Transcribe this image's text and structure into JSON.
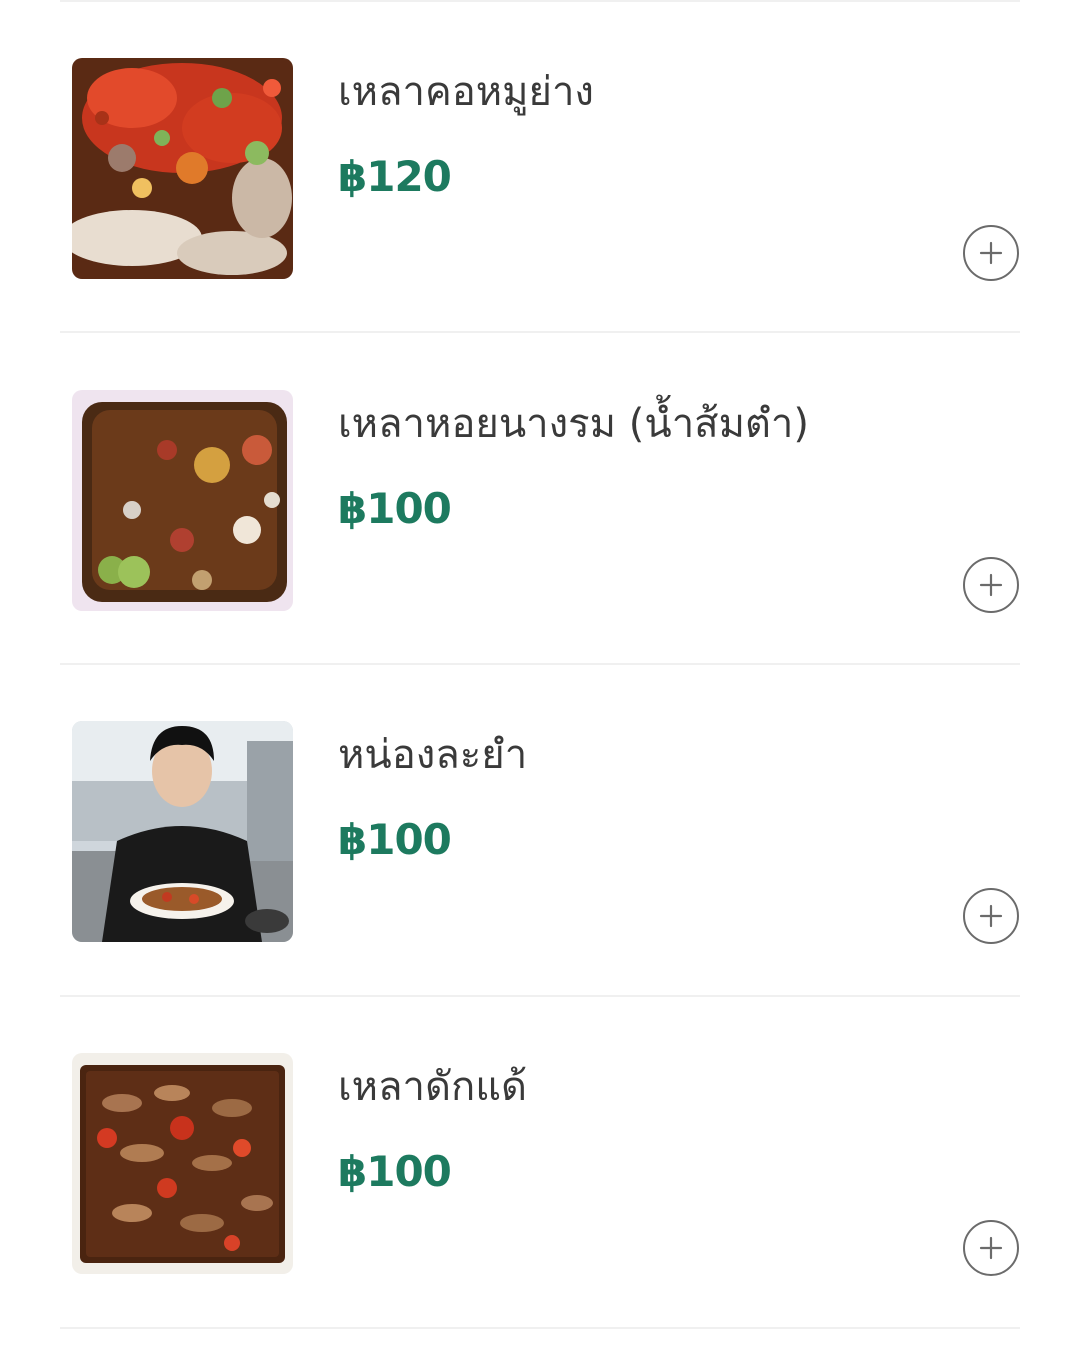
{
  "menu": {
    "items": [
      {
        "name": "เหลาคอหมูย่าง",
        "price": "฿120",
        "image": "grilled-pork-neck-spicy-salad-photo",
        "add_icon": "plus-circle-icon"
      },
      {
        "name": "เหลาหอยนางรม (น้ำส้มตำ)",
        "price": "฿100",
        "image": "oyster-spicy-salad-photo",
        "add_icon": "plus-circle-icon"
      },
      {
        "name": "หน่องละยำ",
        "price": "฿100",
        "image": "man-holding-dish-photo",
        "add_icon": "plus-circle-icon"
      },
      {
        "name": "เหลาดักแด้",
        "price": "฿100",
        "image": "silkworm-pupae-spicy-salad-photo",
        "add_icon": "plus-circle-icon"
      }
    ]
  },
  "colors": {
    "price": "#1d7a5f",
    "name_text": "#3a3a3a",
    "divider": "#f0f0f0",
    "add_button_border": "#6b6b6b"
  }
}
